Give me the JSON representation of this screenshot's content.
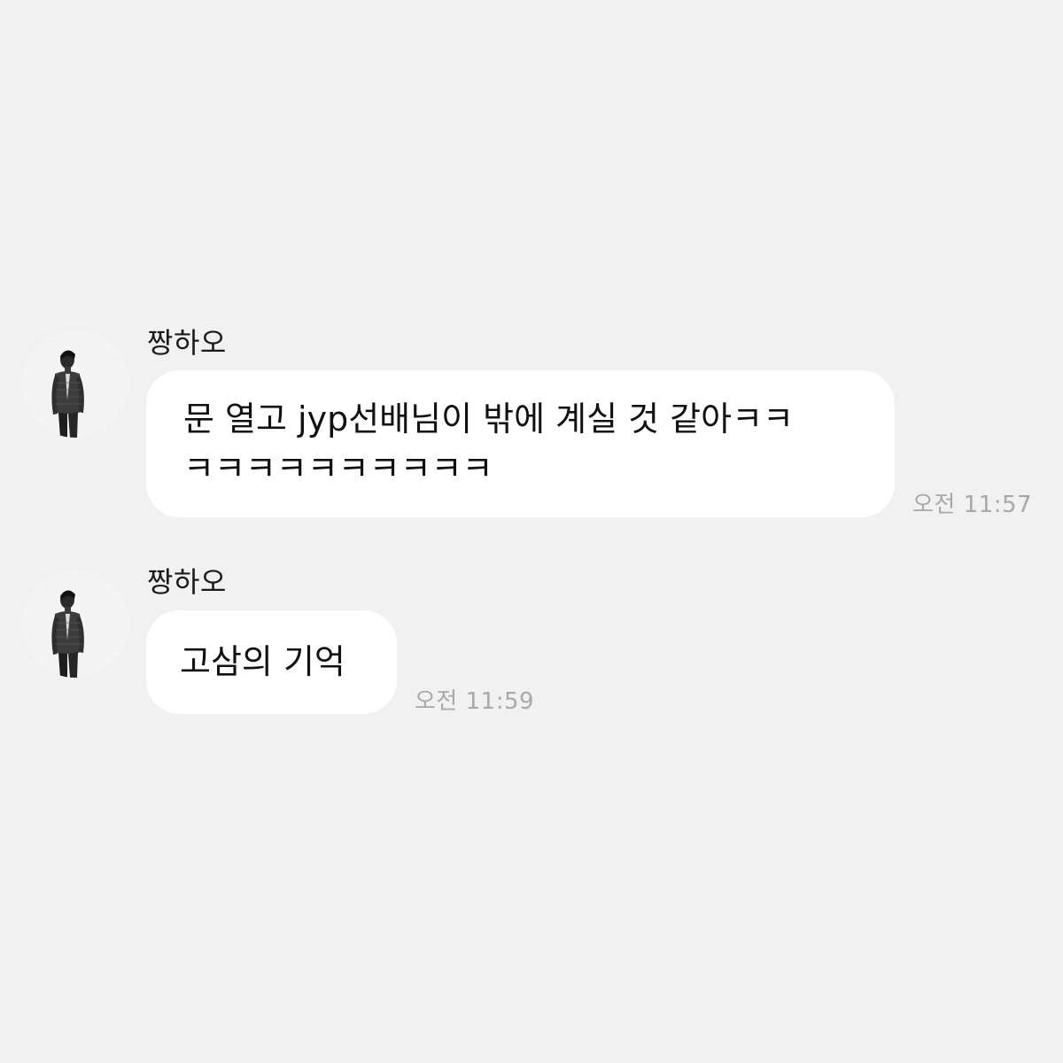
{
  "app": {
    "background_color": "#f1f1f1",
    "bubble_color": "#ffffff",
    "timestamp_color": "#a8a8a8"
  },
  "messages": [
    {
      "sender": "짱하오",
      "avatar_icon": "profile-photo-avatar",
      "lines": [
        "문 열고 jyp선배님이 밖에 계실 것 같아ㅋㅋ",
        "ㅋㅋㅋㅋㅋㅋㅋㅋㅋㅋ"
      ],
      "time": "오전 11:57"
    },
    {
      "sender": "짱하오",
      "avatar_icon": "profile-photo-avatar",
      "lines": [
        "고삼의 기억"
      ],
      "time": "오전 11:59"
    }
  ]
}
